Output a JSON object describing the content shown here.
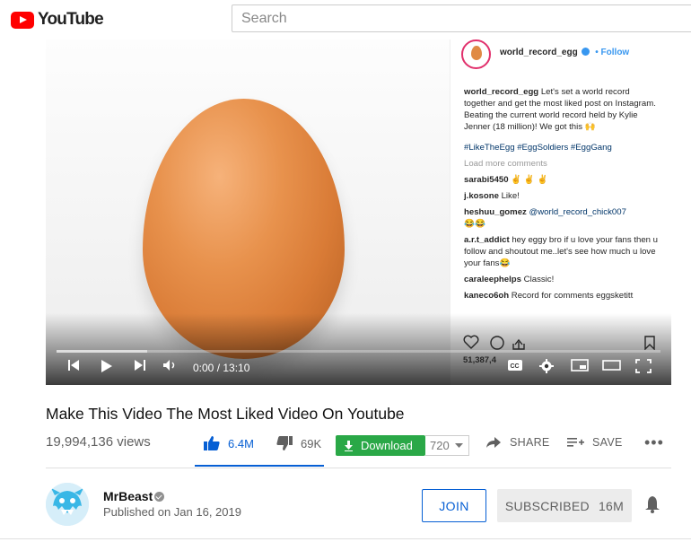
{
  "header": {
    "logo_text": "YouTube",
    "search_placeholder": "Search"
  },
  "player": {
    "time": "0:00 / 13:10",
    "progress_loaded": 0.15,
    "instagram_post": {
      "username": "world_record_egg",
      "follow_label": "Follow",
      "caption_user": "world_record_egg",
      "caption": "Let's set a world record together and get the most liked post on Instagram. Beating the current world record held by Kylie Jenner (18 million)! We got this 🙌",
      "hashtags": "#LikeTheEgg #EggSoldiers #EggGang",
      "load_more": "Load more comments",
      "comments": [
        {
          "user": "sarabi5450",
          "text": "✌ ✌ ✌"
        },
        {
          "user": "j.kosone",
          "text": "Like!"
        },
        {
          "user": "heshuu_gomez",
          "mention": "@world_record_chick007",
          "text": "😂😂"
        },
        {
          "user": "a.r.t_addict",
          "text": "hey eggy bro if u love your fans then u follow and shoutout me..let's see how much u love your fans😂"
        },
        {
          "user": "caraleephelps",
          "text": "Classic!"
        },
        {
          "user": "kaneco6oh",
          "text": "Record for comments eggsketitt"
        }
      ],
      "likes": "51,387,4"
    }
  },
  "video": {
    "title": "Make This Video The Most Liked Video On Youtube",
    "views": "19,994,136 views",
    "likes": "6.4M",
    "dislikes": "69K",
    "download_label": "Download",
    "quality": "720",
    "share_label": "SHARE",
    "save_label": "SAVE",
    "more_label": "•••"
  },
  "channel": {
    "name": "MrBeast",
    "published": "Published on Jan 16, 2019",
    "join_label": "JOIN",
    "subscribed_label": "SUBSCRIBED",
    "subscriber_count": "16M"
  },
  "colors": {
    "brand_red": "#ff0000",
    "link_blue": "#065fd4",
    "download_green": "#2aa847"
  }
}
